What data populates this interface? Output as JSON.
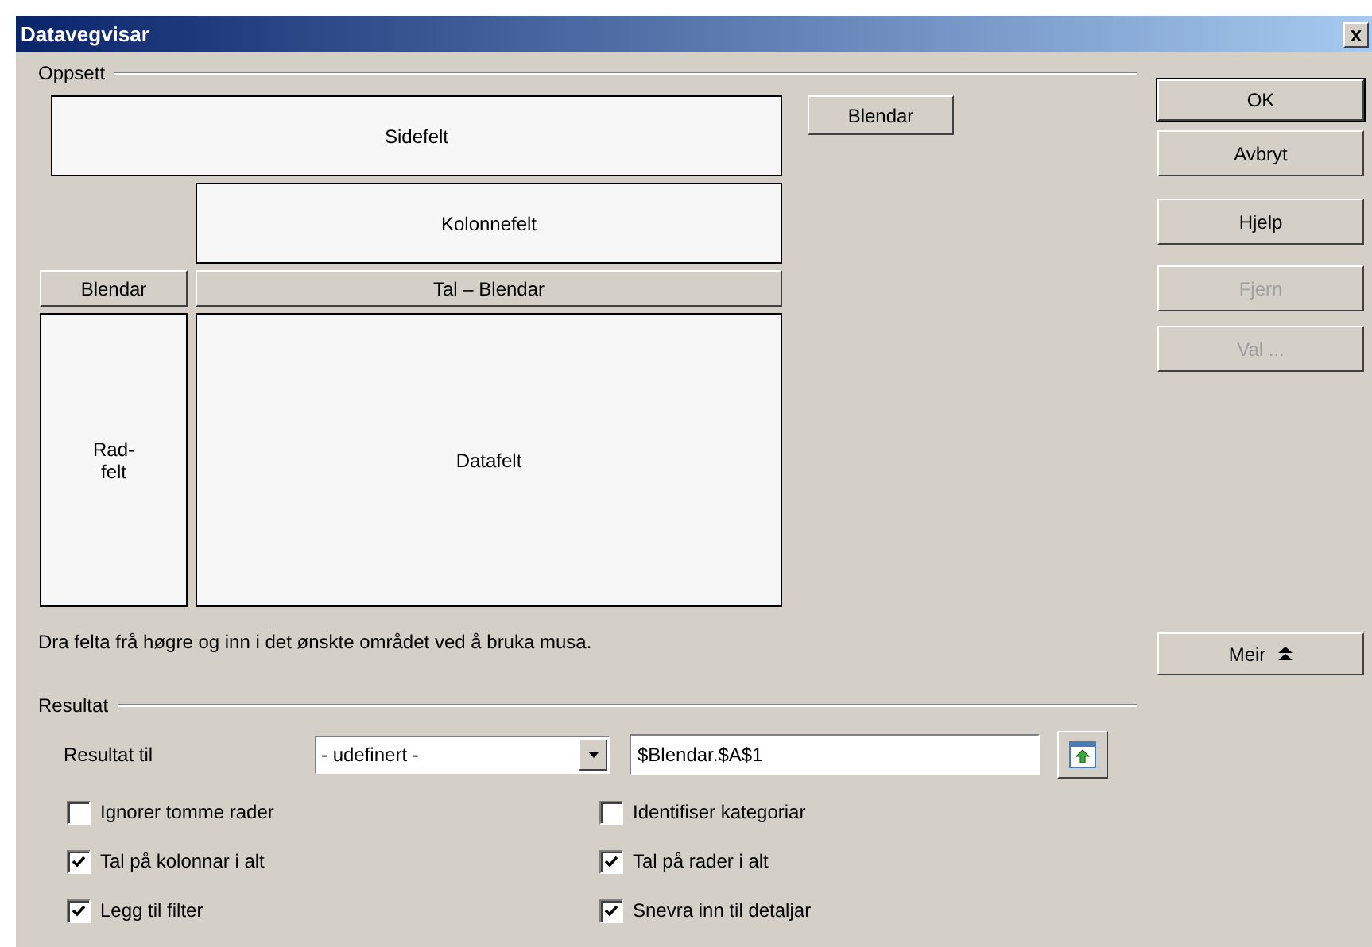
{
  "window": {
    "title": "Datavegvisar",
    "close": "x"
  },
  "layout": {
    "label": "Oppsett",
    "page_field": "Sidefelt",
    "column_field": "Kolonnefelt",
    "row_header": "Blendar",
    "data_header": "Tal – Blendar",
    "row_field": "Rad-felt",
    "data_field": "Datafelt",
    "available_fields": [
      "Blendar"
    ],
    "hint": "Dra felta frå høgre og inn i det ønskte området ved å bruka musa."
  },
  "buttons": [
    {
      "label": "OK",
      "disabled": false,
      "default": true
    },
    {
      "label": "Avbryt",
      "disabled": false,
      "default": false
    },
    {
      "label": "Hjelp",
      "disabled": false,
      "default": false
    },
    {
      "label": "Fjern",
      "disabled": true,
      "default": false
    },
    {
      "label": "Val ...",
      "disabled": true,
      "default": false
    }
  ],
  "more_button": {
    "label": "Meir"
  },
  "result": {
    "label": "Resultat",
    "target_label": "Resultat til",
    "target_select": "- udefinert -",
    "target_value": "$Blendar.$A$1",
    "options": [
      {
        "label": "Ignorer tomme rader",
        "checked": false
      },
      {
        "label": "Identifiser kategoriar",
        "checked": false
      },
      {
        "label": "Tal på kolonnar i alt",
        "checked": true
      },
      {
        "label": "Tal på rader i alt",
        "checked": true
      },
      {
        "label": "Legg til filter",
        "checked": true
      },
      {
        "label": "Snevra inn til detaljar",
        "checked": true
      }
    ]
  }
}
